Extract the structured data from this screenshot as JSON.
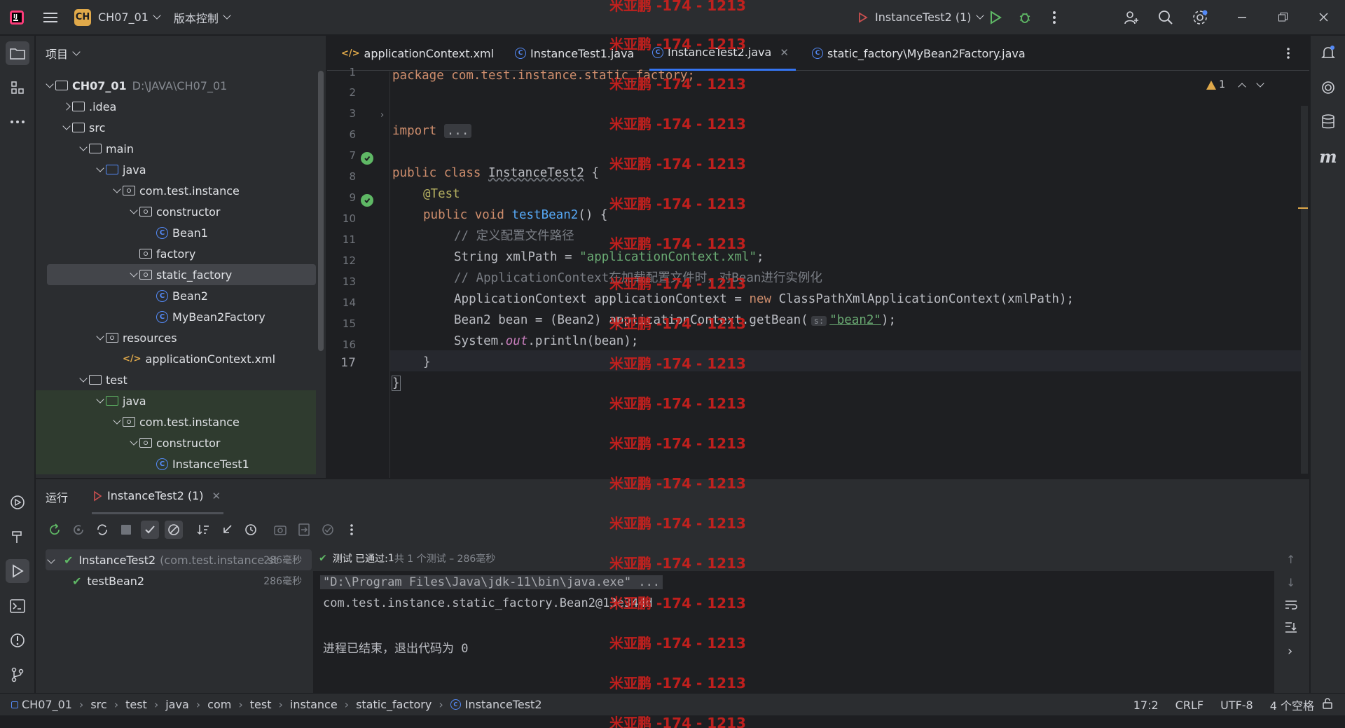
{
  "titlebar": {
    "project_badge": "CH",
    "project_name": "CH07_01",
    "vcs_label": "版本控制",
    "run_config": "InstanceTest2 (1)",
    "icons": [
      "app-logo-icon",
      "hamburger-menu-icon",
      "run-icon",
      "debug-icon",
      "more-icon",
      "add-user-icon",
      "search-icon",
      "settings-icon",
      "minimize-icon",
      "restore-icon",
      "close-icon"
    ]
  },
  "project_panel": {
    "title": "项目",
    "tree": [
      {
        "label": "CH07_01",
        "extra": "D:\\JAVA\\CH07_01",
        "type": "module",
        "depth": 0,
        "expanded": true
      },
      {
        "label": ".idea",
        "type": "folder",
        "depth": 1,
        "expanded": false
      },
      {
        "label": "src",
        "type": "folder",
        "depth": 1,
        "expanded": true
      },
      {
        "label": "main",
        "type": "folder",
        "depth": 2,
        "expanded": true
      },
      {
        "label": "java",
        "type": "src-folder",
        "depth": 3,
        "expanded": true
      },
      {
        "label": "com.test.instance",
        "type": "package",
        "depth": 4,
        "expanded": true
      },
      {
        "label": "constructor",
        "type": "package",
        "depth": 5,
        "expanded": true
      },
      {
        "label": "Bean1",
        "type": "class",
        "depth": 6
      },
      {
        "label": "factory",
        "type": "package",
        "depth": 5
      },
      {
        "label": "static_factory",
        "type": "package",
        "depth": 5,
        "expanded": true,
        "selected": true
      },
      {
        "label": "Bean2",
        "type": "class",
        "depth": 6
      },
      {
        "label": "MyBean2Factory",
        "type": "class",
        "depth": 6
      },
      {
        "label": "resources",
        "type": "res-folder",
        "depth": 3,
        "expanded": true
      },
      {
        "label": "applicationContext.xml",
        "type": "xml",
        "depth": 4
      },
      {
        "label": "test",
        "type": "folder",
        "depth": 2,
        "expanded": true
      },
      {
        "label": "java",
        "type": "test-folder",
        "depth": 3,
        "expanded": true
      },
      {
        "label": "com.test.instance",
        "type": "package",
        "depth": 4,
        "expanded": true
      },
      {
        "label": "constructor",
        "type": "package",
        "depth": 5,
        "expanded": true
      },
      {
        "label": "InstanceTest1",
        "type": "test-class",
        "depth": 6
      }
    ]
  },
  "editor": {
    "tabs": [
      {
        "label": "applicationContext.xml",
        "active": false
      },
      {
        "label": "InstanceTest1.java",
        "active": false
      },
      {
        "label": "InstanceTest2.java",
        "active": true
      },
      {
        "label": "static_factory\\MyBean2Factory.java",
        "active": false
      }
    ],
    "warning_count": "1",
    "line_numbers": [
      "1",
      "2",
      "3",
      "6",
      "7",
      "8",
      "9",
      "10",
      "11",
      "12",
      "13",
      "14",
      "15",
      "16",
      "17"
    ],
    "cursor_line": "17",
    "code": {
      "l1": "package com.test.instance.static_factory;",
      "l3_kw": "import",
      "l3_fold": "...",
      "l7_a": "public class",
      "l7_b": "InstanceTest2",
      "l7_c": " {",
      "l8": "@Test",
      "l9_a": "public void",
      "l9_b": "testBean2",
      "l9_c": "() {",
      "l10": "// 定义配置文件路径",
      "l11_a": "String xmlPath = ",
      "l11_b": "\"applicationContext.xml\"",
      "l11_c": ";",
      "l12": "// ApplicationContext在加载配置文件时，对Bean进行实例化",
      "l13_a": "ApplicationContext applicationContext = ",
      "l13_b": "new",
      "l13_c": " ClassPathXmlApplicationContext(xmlPath);",
      "l14_a": "Bean2 bean = (Bean2) applicationContext.getBean(",
      "l14_hint": "s:",
      "l14_b": "\"bean2\"",
      "l14_c": ");",
      "l15_a": "System.",
      "l15_b": "out",
      "l15_c": ".println(bean);",
      "l16": "}",
      "l17": "}"
    }
  },
  "run_panel": {
    "title": "运行",
    "tab_label": "InstanceTest2 (1)",
    "test_tree": [
      {
        "label": "InstanceTest2",
        "detail": "(com.test.instance.st",
        "time": "286毫秒"
      },
      {
        "label": "testBean2",
        "time": "286毫秒"
      }
    ],
    "status_prefix": "测试 已通过: ",
    "status_count": "1",
    "status_suffix": "共 1 个测试 – 286毫秒",
    "console": [
      "\"D:\\Program Files\\Java\\jdk-11\\bin\\java.exe\" ...",
      "com.test.instance.static_factory.Bean2@13e344d",
      "",
      "进程已结束，退出代码为 0"
    ]
  },
  "statusbar": {
    "breadcrumbs": [
      "CH07_01",
      "src",
      "test",
      "java",
      "com",
      "test",
      "instance",
      "static_factory",
      "InstanceTest2"
    ],
    "position": "17:2",
    "line_ending": "CRLF",
    "encoding": "UTF-8",
    "indent": "4 个空格"
  },
  "watermark": "米亚鹏 -174 - 1213",
  "colors": {
    "accent": "#3574f0",
    "pass": "#5fb865",
    "watermark": "#d1201d",
    "warning": "#e0a94a"
  }
}
